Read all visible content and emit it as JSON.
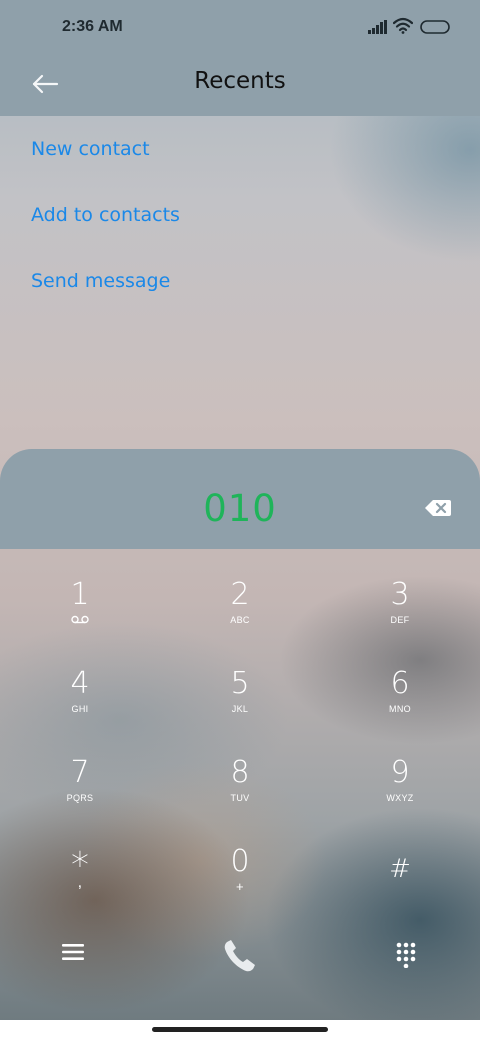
{
  "status_bar": {
    "time": "2:36 AM",
    "icons": [
      "signal-icon",
      "wifi-icon",
      "battery-icon"
    ]
  },
  "header": {
    "back_icon": "arrow-left-icon",
    "title": "Recents"
  },
  "menu": [
    {
      "label": "New contact"
    },
    {
      "label": "Add to contacts"
    },
    {
      "label": "Send message"
    }
  ],
  "dialer": {
    "number": "010",
    "backspace_icon": "backspace-icon",
    "keys": [
      {
        "digit": "1",
        "letters": "",
        "icon": "voicemail-icon"
      },
      {
        "digit": "2",
        "letters": "ABC"
      },
      {
        "digit": "3",
        "letters": "DEF"
      },
      {
        "digit": "4",
        "letters": "GHI"
      },
      {
        "digit": "5",
        "letters": "JKL"
      },
      {
        "digit": "6",
        "letters": "MNO"
      },
      {
        "digit": "7",
        "letters": "PQRS"
      },
      {
        "digit": "8",
        "letters": "TUV"
      },
      {
        "digit": "9",
        "letters": "WXYZ"
      },
      {
        "digit": "*",
        "letters": ","
      },
      {
        "digit": "0",
        "letters": "+"
      },
      {
        "digit": "#",
        "letters": ""
      }
    ]
  },
  "bottom_bar": {
    "left_icon": "menu-icon",
    "center_icon": "phone-call-icon",
    "right_icon": "dialpad-icon"
  },
  "colors": {
    "accent_link": "#1a88e8",
    "dialed_number": "#1fb45a",
    "panel": "#8fa0aa",
    "call_icon": "#e9ecee"
  }
}
